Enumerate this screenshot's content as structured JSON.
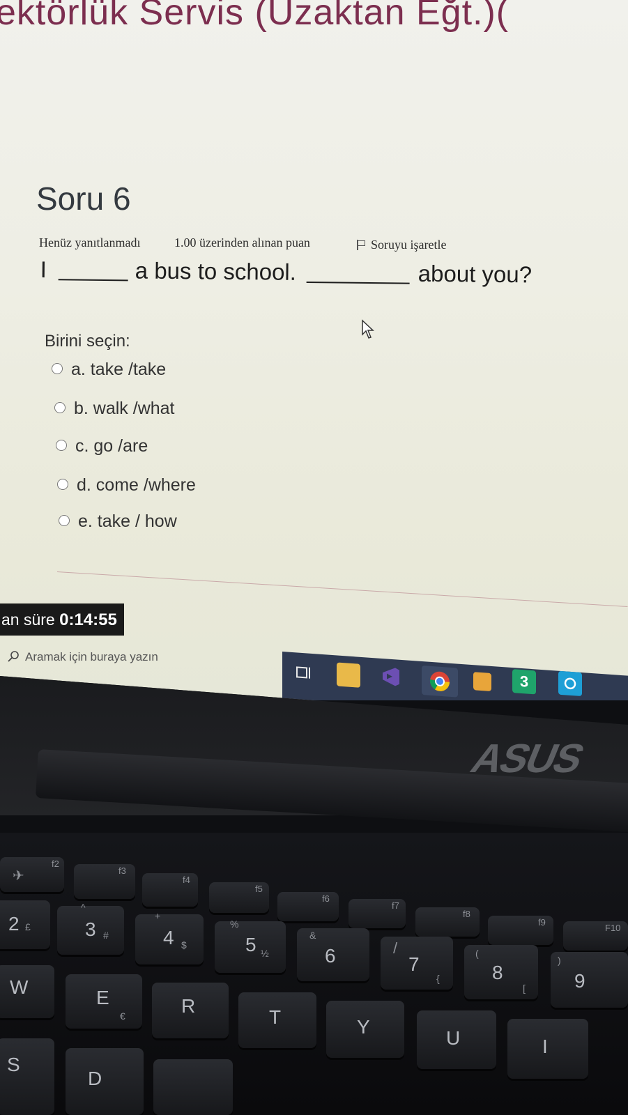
{
  "course_title": "ektörlük Servis (Uzaktan Eğt.)(",
  "question": {
    "number_label": "Soru 6",
    "status": "Henüz yanıtlanmadı",
    "points": "1.00 üzerinden alınan puan",
    "flag_label": "Soruyu işaretle",
    "text_parts": [
      "I",
      "a bus to school.",
      "about you?"
    ]
  },
  "choose_label": "Birini seçin:",
  "options": [
    {
      "label": "a. take /take"
    },
    {
      "label": "b. walk /what"
    },
    {
      "label": "c. go /are"
    },
    {
      "label": "d. come /where"
    },
    {
      "label": "e. take / how"
    }
  ],
  "timer": {
    "label": "an süre",
    "value": "0:14:55"
  },
  "taskbar": {
    "search_placeholder": "Aramak için buraya yazın",
    "icons": [
      "task-view-icon",
      "file-explorer-icon",
      "visual-studio-icon",
      "chrome-icon",
      "app-icon",
      "badge-3-icon",
      "camera-icon"
    ],
    "badge_text": "3"
  },
  "laptop": {
    "brand": "ASUS",
    "fkeys": [
      "f2",
      "f3",
      "f4",
      "f5",
      "f6",
      "f7",
      "f8",
      "f9",
      "F10"
    ],
    "number_keys": [
      {
        "main": "2",
        "shift": "£"
      },
      {
        "main": "3",
        "shift": "#"
      },
      {
        "main": "4",
        "shift": "$"
      },
      {
        "main": "5",
        "shift": "½"
      },
      {
        "main": "6",
        "shift": "&"
      },
      {
        "main": "7",
        "shift": "/"
      },
      {
        "main": "8",
        "shift": "("
      },
      {
        "main": "9",
        "shift": ")"
      }
    ],
    "letter_keys": [
      "W",
      "E",
      "R",
      "T",
      "Y",
      "U",
      "I"
    ],
    "bottom_keys": [
      "S",
      "D"
    ],
    "extra_symbols": [
      "^",
      "+",
      "%",
      "€",
      "{",
      "["
    ]
  }
}
